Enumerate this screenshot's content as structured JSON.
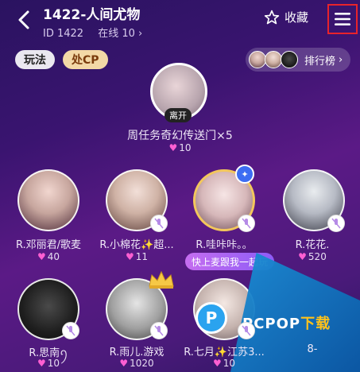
{
  "header": {
    "title": "1422-人间尤物",
    "room_id": "ID 1422",
    "online": "在线 10",
    "online_chevron": "›",
    "favorite_label": "收藏"
  },
  "tags": {
    "play": "玩法",
    "cp": "处CP"
  },
  "rank": {
    "label": "排行榜",
    "chevron": "›"
  },
  "host": {
    "leave_label": "离开",
    "name": "周任务奇幻传送门×5",
    "likes": "10"
  },
  "seats": [
    {
      "name": "R.邓丽君/歌麦",
      "likes": "40"
    },
    {
      "name": "R.小棉花✨超...",
      "likes": "11"
    },
    {
      "name": "R.哇咔咔。。",
      "likes": "1"
    },
    {
      "name": "R.花花.",
      "likes": "520"
    },
    {
      "name": "R.思南ꪆ",
      "likes": "10"
    },
    {
      "name": "R.雨儿.游戏",
      "likes": "1020"
    },
    {
      "name": "R.七月✨江苏3...",
      "likes": "10"
    },
    {
      "name": "8-",
      "likes": ""
    }
  ],
  "quick_mic_label": "快上麦跟我一起玩",
  "watermark": {
    "logo_letter": "P",
    "text": "PCPOP",
    "text_cn": "下载"
  },
  "heart_symbol": "♥",
  "colors": {
    "accent_pink": "#ff5fd2",
    "menu_highlight": "#e8232b",
    "cp_tag_bg": "#f3d8a6"
  }
}
